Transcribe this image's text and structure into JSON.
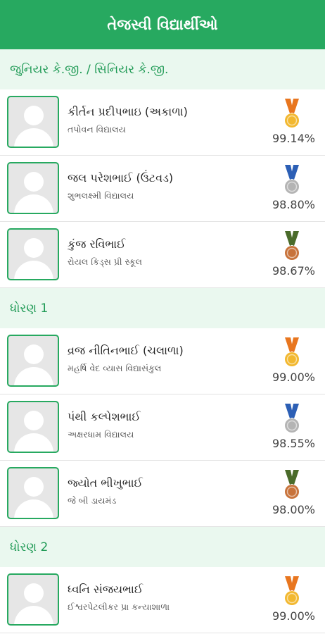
{
  "header": {
    "title": "તેજસ્વી વિદ્યાર્થીઓ"
  },
  "sections": [
    {
      "title": "જુનિયર કે.જી. / સિનિયર કે.જી.",
      "students": [
        {
          "name": "કીર્તન પ્રદીપભાઇ (અકાળા)",
          "school": "તપોવન વિદ્યાલય",
          "percent": "99.14%",
          "medal": "gold"
        },
        {
          "name": "જલ પરેશભાઈ (ઉંટવડ)",
          "school": "શુભલક્ષ્મી વિદ્યાલય",
          "percent": "98.80%",
          "medal": "silver"
        },
        {
          "name": "કુંજ રવિભાઈ",
          "school": "રોયલ કિડ્સ પ્રી સ્કૂલ",
          "percent": "98.67%",
          "medal": "bronze"
        }
      ]
    },
    {
      "title": "ધોરણ 1",
      "students": [
        {
          "name": "વ્રજ નીતિનભાઈ (ચલાળા)",
          "school": "મહર્ષિ વેદ વ્યાસ વિદ્યાસંકુલ",
          "percent": "99.00%",
          "medal": "gold"
        },
        {
          "name": "પંથી કલ્પેશભાઈ",
          "school": "અક્ષરધામ વિદ્યાલય",
          "percent": "98.55%",
          "medal": "silver"
        },
        {
          "name": "જ્યોત ભીખુભાઈ",
          "school": "જે બી ડાયમંડ",
          "percent": "98.00%",
          "medal": "bronze"
        }
      ]
    },
    {
      "title": "ધોરણ 2",
      "students": [
        {
          "name": "ધ્વનિ સંજયભાઈ",
          "school": "ઈશ્વરપેટલીકર પ્રા કન્યાશાળા",
          "percent": "99.00%",
          "medal": "gold"
        }
      ]
    }
  ],
  "medal_colors": {
    "gold": {
      "ribbon": "#e8761f",
      "coin": "#f2b830"
    },
    "silver": {
      "ribbon": "#2c5fb5",
      "coin": "#b4b4b4"
    },
    "bronze": {
      "ribbon": "#4a6b2a",
      "coin": "#c8733b"
    }
  },
  "colors": {
    "accent": "#27a960",
    "section_bg": "#eaf8ef"
  }
}
